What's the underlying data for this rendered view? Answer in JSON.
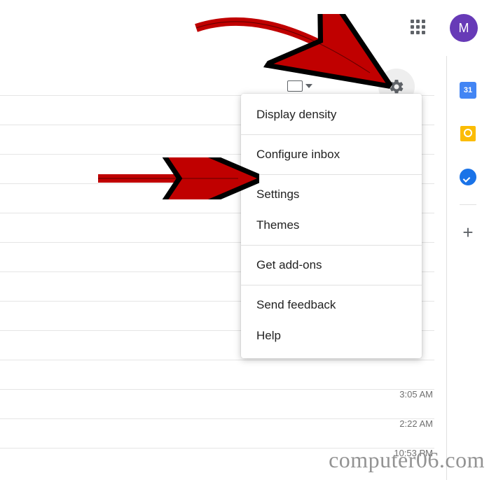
{
  "header": {
    "avatar_initial": "M"
  },
  "side": {
    "calendar_date": "31",
    "plus": "+"
  },
  "menu": {
    "display_density": "Display density",
    "configure_inbox": "Configure inbox",
    "settings": "Settings",
    "themes": "Themes",
    "get_addons": "Get add-ons",
    "send_feedback": "Send feedback",
    "help": "Help"
  },
  "times": {
    "t1": "3:05 AM",
    "t2": "2:22 AM",
    "t3": "10:53 PM"
  },
  "watermark": "computer06.com"
}
